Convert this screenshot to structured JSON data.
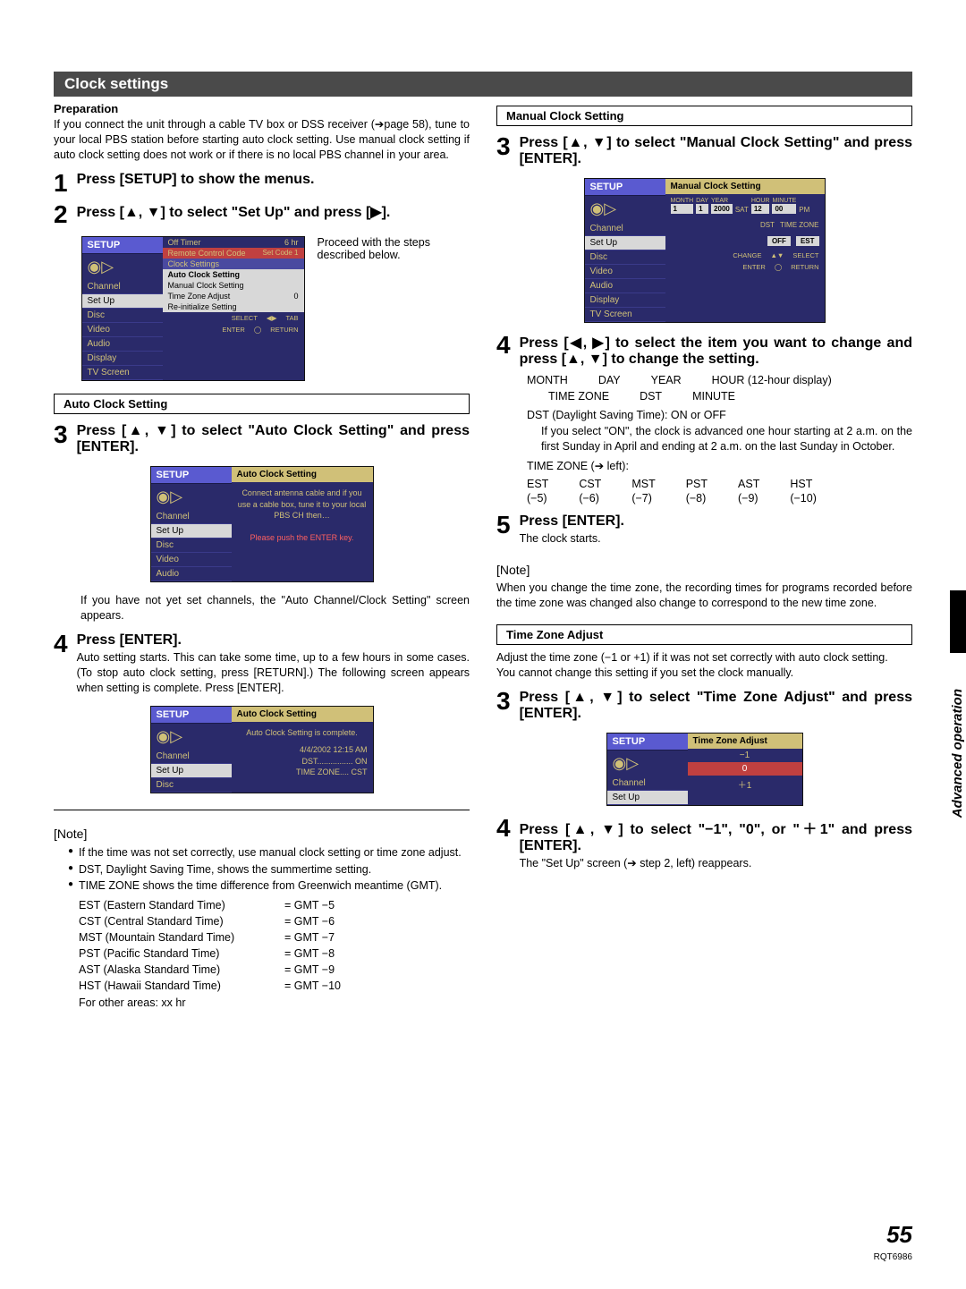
{
  "section_title": "Clock settings",
  "left": {
    "prep_title": "Preparation",
    "prep_body": "If you connect the unit through a cable TV box or DSS receiver (➔page 58), tune to your local PBS station before starting auto clock setting. Use manual clock setting if auto clock setting does not work or if there is no local PBS channel in your area.",
    "step1_label": "Press [SETUP] to show the menus.",
    "step2_label": "Press [▲, ▼] to select \"Set Up\" and press [▶].",
    "osd1_note": "Proceed with the steps described below.",
    "osd1": {
      "hdr": "SETUP",
      "menu": [
        "Channel",
        "Set Up",
        "Disc",
        "Video",
        "Audio",
        "Display",
        "TV Screen"
      ],
      "r_off_timer": "Off Timer",
      "r_off_timer_v": "6 hr",
      "r_remote": "Remote Control Code",
      "r_remote_v": "Set Code 1",
      "r_clock": "Clock Settings",
      "r_auto": "Auto Clock Setting",
      "r_manual": "Manual Clock Setting",
      "r_tz": "Time Zone Adjust",
      "r_tz_v": "0",
      "r_reinit": "Re-initialize Setting",
      "foot_select": "SELECT",
      "foot_tab": "TAB",
      "foot_enter": "ENTER",
      "foot_return": "RETURN"
    },
    "sub_auto": "Auto Clock Setting",
    "step3_label": "Press [▲, ▼] to select \"Auto Clock Setting\" and press [ENTER].",
    "osd2": {
      "hdr": "SETUP",
      "menu": [
        "Channel",
        "Set Up",
        "Disc",
        "Video",
        "Audio"
      ],
      "rhdr": "Auto Clock Setting",
      "msg1": "Connect antenna cable and if you use a cable box, tune it to your local PBS CH then…",
      "msg2": "Please push the ENTER key."
    },
    "after_osd2": "If you have not yet set channels, the \"Auto Channel/Clock Setting\" screen appears.",
    "step4_label": "Press [ENTER].",
    "step4_body": "Auto setting starts. This can take some time, up to a few hours in some cases. (To stop auto clock setting, press [RETURN].) The following screen appears when setting is complete. Press [ENTER].",
    "osd3": {
      "hdr": "SETUP",
      "menu": [
        "Channel",
        "Set Up",
        "Disc"
      ],
      "rhdr": "Auto Clock Setting",
      "msg1": "Auto Clock Setting is complete.",
      "line1": "4/4/2002 12:15 AM",
      "line2": "DST................ ON",
      "line3": "TIME ZONE.... CST"
    },
    "note_head": "Note",
    "note_bullets": [
      "If the time was not set correctly, use manual clock setting or time zone adjust.",
      "DST, Daylight Saving Time, shows the summertime setting.",
      "TIME ZONE shows the time difference from Greenwich meantime (GMT)."
    ],
    "tz_rows": [
      {
        "c1": "EST (Eastern Standard Time)",
        "c2": "= GMT −5"
      },
      {
        "c1": "CST (Central Standard Time)",
        "c2": "= GMT −6"
      },
      {
        "c1": "MST (Mountain Standard Time)",
        "c2": "= GMT −7"
      },
      {
        "c1": "PST (Pacific Standard Time)",
        "c2": "= GMT −8"
      },
      {
        "c1": "AST (Alaska Standard Time)",
        "c2": "= GMT −9"
      },
      {
        "c1": "HST (Hawaii Standard Time)",
        "c2": "= GMT −10"
      },
      {
        "c1": "For other areas: xx hr",
        "c2": ""
      }
    ]
  },
  "right": {
    "sub_manual": "Manual Clock Setting",
    "step3_label": "Press [▲, ▼] to select \"Manual Clock Setting\" and press [ENTER].",
    "osd4": {
      "hdr": "SETUP",
      "menu": [
        "Channel",
        "Set Up",
        "Disc",
        "Video",
        "Audio",
        "Display",
        "TV Screen"
      ],
      "rhdr": "Manual Clock Setting",
      "cols": [
        "MONTH",
        "DAY",
        "YEAR",
        "",
        "HOUR",
        "MINUTE",
        ""
      ],
      "vals": [
        "1",
        "1",
        "2000",
        "SAT",
        "12",
        "00",
        "PM"
      ],
      "dst_lbl": "DST",
      "tz_lbl": "TIME ZONE",
      "dst_v": "OFF",
      "tz_v": "EST",
      "foot_change": "CHANGE",
      "foot_select": "SELECT",
      "foot_enter": "ENTER",
      "foot_return": "RETURN"
    },
    "step4_label": "Press [◀, ▶] to select the item you want to change and press [▲, ▼] to change the setting.",
    "items_row1": [
      "MONTH",
      "DAY",
      "YEAR",
      "HOUR (12-hour display)"
    ],
    "items_row2": [
      "TIME ZONE",
      "DST",
      "MINUTE"
    ],
    "dst_line": "DST (Daylight Saving Time): ON or OFF",
    "dst_explain": "If you select \"ON\", the clock is advanced one hour starting at 2 a.m. on the first Sunday in April and ending at 2 a.m. on the last Sunday in October.",
    "tz_head": "TIME ZONE (➔ left):",
    "tz_abbr": [
      {
        "a": "EST",
        "b": "(−5)"
      },
      {
        "a": "CST",
        "b": "(−6)"
      },
      {
        "a": "MST",
        "b": "(−7)"
      },
      {
        "a": "PST",
        "b": "(−8)"
      },
      {
        "a": "AST",
        "b": "(−9)"
      },
      {
        "a": "HST",
        "b": "(−10)"
      }
    ],
    "step5_label": "Press [ENTER].",
    "step5_body": "The clock starts.",
    "note_head": "Note",
    "note_body": "When you change the time zone, the recording times for programs recorded before the time zone was changed also change to correspond to the new time zone.",
    "sub_tz": "Time Zone Adjust",
    "tz_body1": "Adjust the time zone (−1 or +1) if it was not set correctly with auto clock setting.",
    "tz_body2": "You cannot change this setting if you set the clock manually.",
    "step3b_label": "Press [▲, ▼] to select \"Time Zone Adjust\" and press [ENTER].",
    "osd5": {
      "hdr": "SETUP",
      "menu": [
        "Channel",
        "Set Up"
      ],
      "rhdr": "Time Zone Adjust",
      "opts": [
        "−1",
        "0",
        "＋1"
      ]
    },
    "step4b_label": "Press [▲, ▼] to select \"−1\", \"0\", or \"＋1\" and press [ENTER].",
    "step4b_body": "The \"Set Up\" screen (➔ step 2, left) reappears."
  },
  "side_tab": "Advanced operation",
  "page_foot": {
    "num": "55",
    "doc": "RQT6986"
  }
}
